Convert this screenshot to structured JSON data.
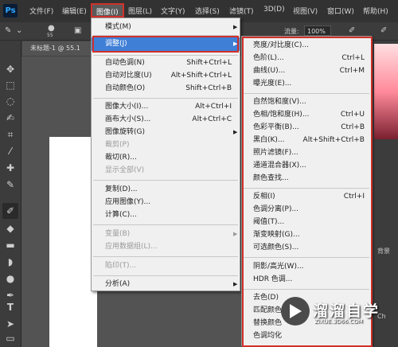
{
  "app": {
    "logo": "Ps"
  },
  "menubar": {
    "items": [
      "文件(F)",
      "编辑(E)",
      "图像(I)",
      "图层(L)",
      "文字(Y)",
      "选择(S)",
      "滤镜(T)",
      "3D(D)",
      "视图(V)",
      "窗口(W)",
      "帮助(H)"
    ],
    "active_index": 2
  },
  "options_bar": {
    "brush_size": "55",
    "flow_label": "流量:",
    "flow_value": "100%"
  },
  "document": {
    "tab_title": "未标题-1 @ 55.1"
  },
  "image_menu": {
    "items": [
      {
        "label": "模式(M)",
        "shortcut": "",
        "submenu": true,
        "disabled": false
      },
      {
        "label": "调整(J)",
        "shortcut": "",
        "submenu": true,
        "disabled": false,
        "highlighted": true
      },
      {
        "label": "自动色调(N)",
        "shortcut": "Shift+Ctrl+L",
        "disabled": false
      },
      {
        "label": "自动对比度(U)",
        "shortcut": "Alt+Shift+Ctrl+L",
        "disabled": false
      },
      {
        "label": "自动颜色(O)",
        "shortcut": "Shift+Ctrl+B",
        "disabled": false
      },
      {
        "label": "图像大小(I)...",
        "shortcut": "Alt+Ctrl+I",
        "disabled": false
      },
      {
        "label": "画布大小(S)...",
        "shortcut": "Alt+Ctrl+C",
        "disabled": false
      },
      {
        "label": "图像旋转(G)",
        "shortcut": "",
        "submenu": true,
        "disabled": false
      },
      {
        "label": "裁剪(P)",
        "shortcut": "",
        "disabled": true
      },
      {
        "label": "裁切(R)...",
        "shortcut": "",
        "disabled": false
      },
      {
        "label": "显示全部(V)",
        "shortcut": "",
        "disabled": true
      },
      {
        "label": "复制(D)...",
        "shortcut": "",
        "disabled": false
      },
      {
        "label": "应用图像(Y)...",
        "shortcut": "",
        "disabled": false
      },
      {
        "label": "计算(C)...",
        "shortcut": "",
        "disabled": false
      },
      {
        "label": "变量(B)",
        "shortcut": "",
        "submenu": true,
        "disabled": true
      },
      {
        "label": "应用数据组(L)...",
        "shortcut": "",
        "disabled": true
      },
      {
        "label": "陷印(T)...",
        "shortcut": "",
        "disabled": true
      },
      {
        "label": "分析(A)",
        "shortcut": "",
        "submenu": true,
        "disabled": false
      }
    ]
  },
  "adjust_submenu": {
    "items": [
      {
        "label": "亮度/对比度(C)...",
        "shortcut": ""
      },
      {
        "label": "色阶(L)...",
        "shortcut": "Ctrl+L"
      },
      {
        "label": "曲线(U)...",
        "shortcut": "Ctrl+M"
      },
      {
        "label": "曝光度(E)...",
        "shortcut": ""
      },
      {
        "label": "自然饱和度(V)...",
        "shortcut": ""
      },
      {
        "label": "色相/饱和度(H)...",
        "shortcut": "Ctrl+U"
      },
      {
        "label": "色彩平衡(B)...",
        "shortcut": "Ctrl+B"
      },
      {
        "label": "黑白(K)...",
        "shortcut": "Alt+Shift+Ctrl+B"
      },
      {
        "label": "照片滤镜(F)...",
        "shortcut": ""
      },
      {
        "label": "通道混合器(X)...",
        "shortcut": ""
      },
      {
        "label": "颜色查找...",
        "shortcut": ""
      },
      {
        "label": "反相(I)",
        "shortcut": "Ctrl+I"
      },
      {
        "label": "色调分离(P)...",
        "shortcut": ""
      },
      {
        "label": "阈值(T)...",
        "shortcut": ""
      },
      {
        "label": "渐变映射(G)...",
        "shortcut": ""
      },
      {
        "label": "可选颜色(S)...",
        "shortcut": ""
      },
      {
        "label": "阴影/高光(W)...",
        "shortcut": ""
      },
      {
        "label": "HDR 色调...",
        "shortcut": ""
      },
      {
        "label": "去色(D)",
        "shortcut": ""
      },
      {
        "label": "匹配颜色",
        "shortcut": ""
      },
      {
        "label": "替换颜色",
        "shortcut": ""
      },
      {
        "label": "色调均化",
        "shortcut": ""
      }
    ]
  },
  "right_panel": {
    "labels": [
      "背景",
      "Ch"
    ]
  },
  "watermark": {
    "title": "溜溜自学",
    "url": "ZIXUE.3D66.COM"
  },
  "colors": {
    "highlight": "#3f7fd6",
    "annotation_red": "#d0302a",
    "menubar_bg": "#323232"
  }
}
